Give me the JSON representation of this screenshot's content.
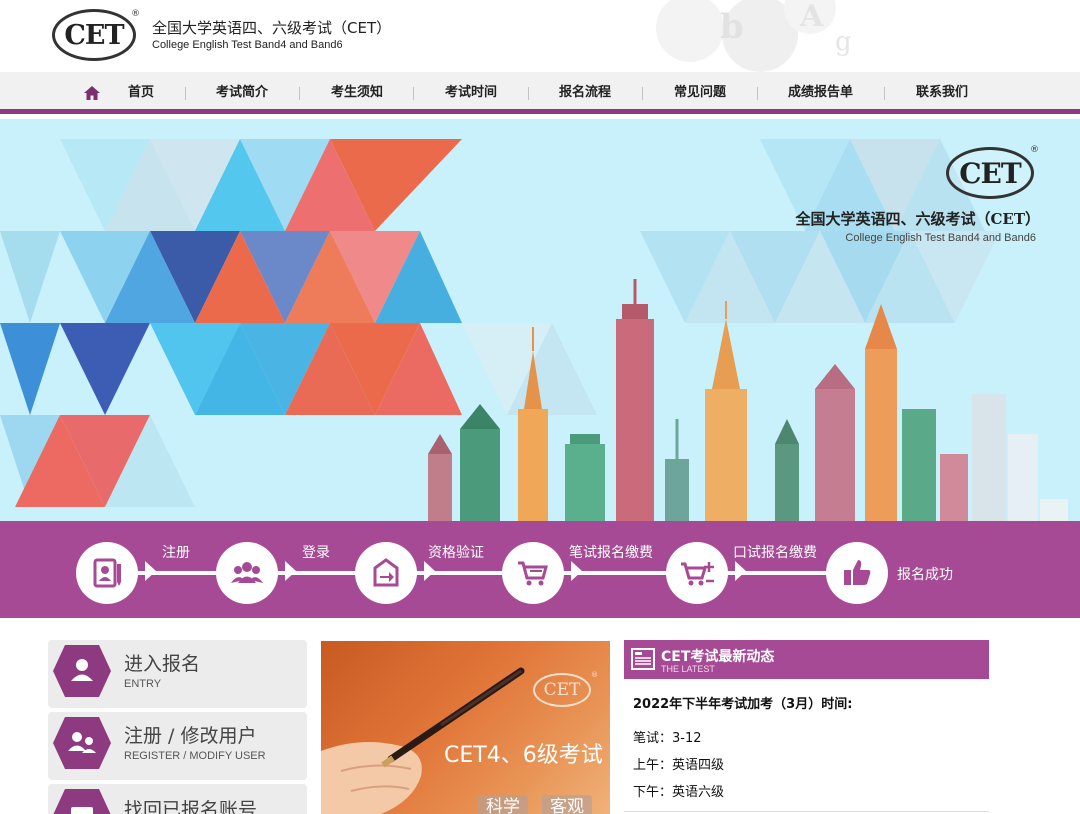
{
  "header": {
    "logo_text": "CET",
    "logo_reg": "®",
    "title_cn": "全国大学英语四、六级考试（CET）",
    "title_en": "College English Test Band4 and Band6"
  },
  "nav": {
    "home_icon": "home-icon",
    "items": [
      "首页",
      "考试简介",
      "考生须知",
      "考试时间",
      "报名流程",
      "常见问题",
      "成绩报告单",
      "联系我们"
    ]
  },
  "banner": {
    "logo_text": "CET",
    "logo_reg": "®",
    "title_cn": "全国大学英语四、六级考试（CET）",
    "title_en": "College English Test Band4 and Band6"
  },
  "steps": [
    {
      "label": "注册",
      "icon": "register-icon"
    },
    {
      "label": "登录",
      "icon": "users-icon"
    },
    {
      "label": "资格验证",
      "icon": "verify-icon"
    },
    {
      "label": "笔试报名缴费",
      "icon": "cart-icon"
    },
    {
      "label": "口试报名缴费",
      "icon": "cart-plus-icon"
    },
    {
      "label": "报名成功",
      "icon": "thumbs-up-icon"
    }
  ],
  "side_menu": [
    {
      "title": "进入报名",
      "subtitle": "ENTRY",
      "icon": "user-icon"
    },
    {
      "title": "注册 / 修改用户",
      "subtitle": "REGISTER / MODIFY USER",
      "icon": "users-icon"
    },
    {
      "title": "找回已报名账号",
      "subtitle": "",
      "icon": "account-icon"
    }
  ],
  "promo": {
    "logo_text": "CET",
    "logo_reg": "®",
    "title": "CET4、6级考试",
    "tags": [
      "科学",
      "客观"
    ]
  },
  "news": {
    "title": "CET考试最新动态",
    "subtitle": "THE LATEST",
    "icon": "news-icon",
    "headline": "2022年下半年考试加考（3月）时间:",
    "lines": [
      "笔试：3-12",
      "上午：英语四级",
      "下午：英语六级"
    ]
  },
  "colors": {
    "brand_purple": "#a74a96",
    "nav_bg": "#f1f1f1",
    "banner_bg": "#c8f1fb"
  }
}
